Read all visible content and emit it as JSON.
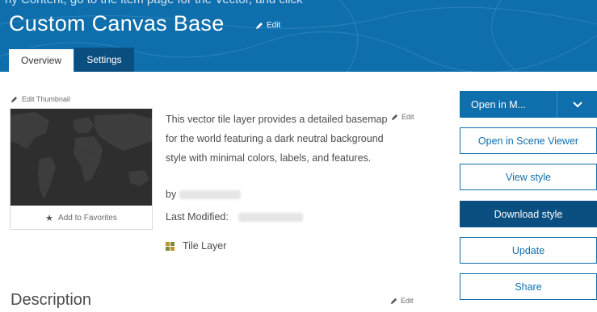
{
  "colors": {
    "brand": "#0f6fad",
    "brand_dark": "#0a4f80"
  },
  "header": {
    "cropped_text": "ny Content, go to the item page for the Vector, and click",
    "title": "Custom Canvas Base",
    "edit_label": "Edit",
    "tabs": [
      {
        "label": "Overview",
        "active": true
      },
      {
        "label": "Settings",
        "active": false
      }
    ]
  },
  "thumbnail": {
    "edit_label": "Edit Thumbnail",
    "favorite_label": "Add to Favorites"
  },
  "summary": {
    "text": "This vector tile layer provides a detailed basemap for the world featuring a dark neutral background style with minimal colors, labels, and features.",
    "edit_label": "Edit",
    "by_label": "by",
    "last_modified_label": "Last Modified:",
    "item_type": "Tile Layer",
    "item_type_icon": "tile-layer-icon"
  },
  "description": {
    "title": "Description",
    "edit_label": "Edit"
  },
  "actions": {
    "open_in_map": "Open in M...",
    "open_in_scene_viewer": "Open in Scene Viewer",
    "view_style": "View style",
    "download_style": "Download style",
    "update": "Update",
    "share": "Share"
  }
}
